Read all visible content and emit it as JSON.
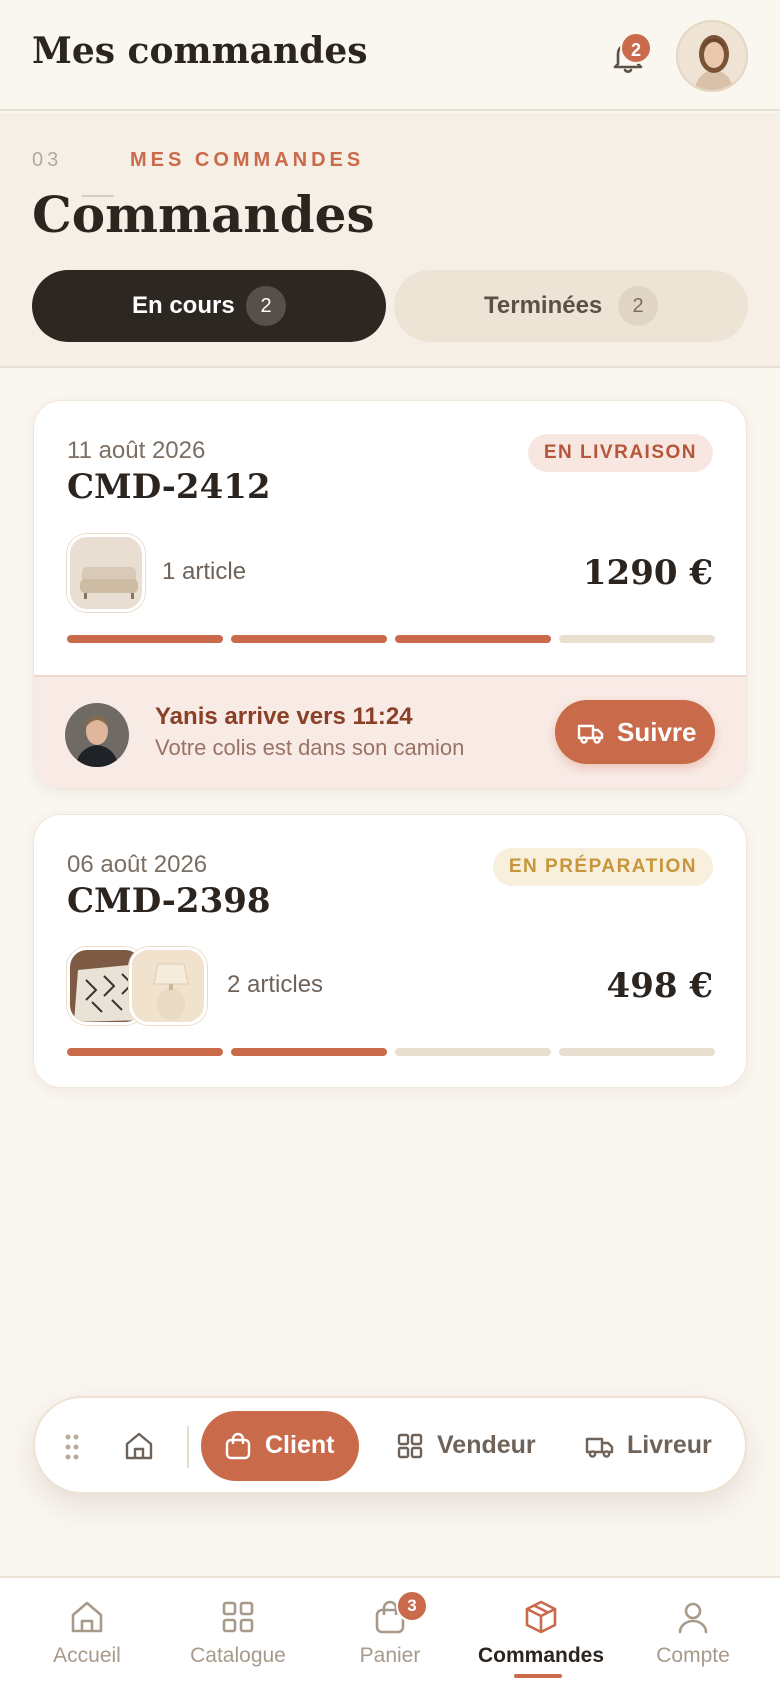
{
  "header": {
    "title": "Mes commandes",
    "notifications_count": "2",
    "avatar_icon": "user-avatar-woman"
  },
  "section": {
    "eyebrow_number": "03",
    "eyebrow_label": "MES COMMANDES",
    "title": "Commandes"
  },
  "tabs": [
    {
      "label": "En cours",
      "count": "2",
      "active": true
    },
    {
      "label": "Terminées",
      "count": "2",
      "active": false
    }
  ],
  "orders": [
    {
      "date": "11 août 2026",
      "id": "CMD-2412",
      "status": "EN LIVRAISON",
      "articles": "1 article",
      "price": "1290 €",
      "progress_steps_done": 3,
      "progress_steps_total": 4,
      "thumbnails": [
        "sofa-image"
      ],
      "courier": {
        "title": "Yanis arrive vers 11:24",
        "subtitle": "Votre colis est dans son camion",
        "button_label": "Suivre"
      }
    },
    {
      "date": "06 août 2026",
      "id": "CMD-2398",
      "status": "EN PRÉPARATION",
      "articles": "2 articles",
      "price": "498 €",
      "progress_steps_done": 2,
      "progress_steps_total": 4,
      "thumbnails": [
        "rug-image",
        "lamp-image"
      ]
    }
  ],
  "role_switcher": {
    "items": [
      {
        "label": "Client",
        "icon": "bag-icon",
        "active": true
      },
      {
        "label": "Vendeur",
        "icon": "grid-icon",
        "active": false
      },
      {
        "label": "Livreur",
        "icon": "truck-icon",
        "active": false
      }
    ]
  },
  "bottom_nav": {
    "items": [
      {
        "label": "Accueil",
        "icon": "home-icon"
      },
      {
        "label": "Catalogue",
        "icon": "grid-icon"
      },
      {
        "label": "Panier",
        "icon": "bag-icon",
        "badge": "3"
      },
      {
        "label": "Commandes",
        "icon": "box-icon",
        "active": true
      },
      {
        "label": "Compte",
        "icon": "user-icon"
      }
    ]
  },
  "colors": {
    "accent": "#c96a4a",
    "dark": "#2d2722",
    "background": "#faf6f0",
    "status_delivery_bg": "#f8e6e0",
    "status_prep_text": "#c8963a"
  }
}
